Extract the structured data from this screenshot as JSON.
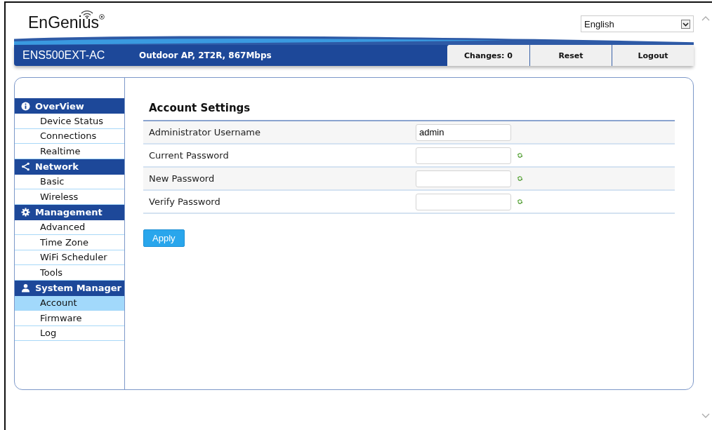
{
  "header": {
    "logo": "EnGenius",
    "model": "ENS500EXT-AC",
    "description": "Outdoor AP, 2T2R, 867Mbps",
    "language": "English",
    "buttons": [
      "Changes: 0",
      "Reset",
      "Logout"
    ]
  },
  "sidebar": [
    {
      "title": "OverView",
      "items": [
        {
          "label": "Device Status",
          "selected": false
        },
        {
          "label": "Connections",
          "selected": false
        },
        {
          "label": "Realtime",
          "selected": false
        }
      ]
    },
    {
      "title": "Network",
      "items": [
        {
          "label": "Basic",
          "selected": false
        },
        {
          "label": "Wireless",
          "selected": false
        }
      ]
    },
    {
      "title": "Management",
      "items": [
        {
          "label": "Advanced",
          "selected": false
        },
        {
          "label": "Time Zone",
          "selected": false
        },
        {
          "label": "WiFi Scheduler",
          "selected": false
        },
        {
          "label": "Tools",
          "selected": false
        }
      ]
    },
    {
      "title": "System Manager",
      "items": [
        {
          "label": "Account",
          "selected": true
        },
        {
          "label": "Firmware",
          "selected": false
        },
        {
          "label": "Log",
          "selected": false
        }
      ]
    }
  ],
  "content": {
    "title": "Account Settings",
    "fields": [
      {
        "label": "Administrator Username",
        "kind": "text",
        "value": "admin"
      },
      {
        "label": "Current Password",
        "kind": "password"
      },
      {
        "label": "New Password",
        "kind": "password"
      },
      {
        "label": "Verify Password",
        "kind": "password"
      }
    ],
    "button": "Apply"
  }
}
